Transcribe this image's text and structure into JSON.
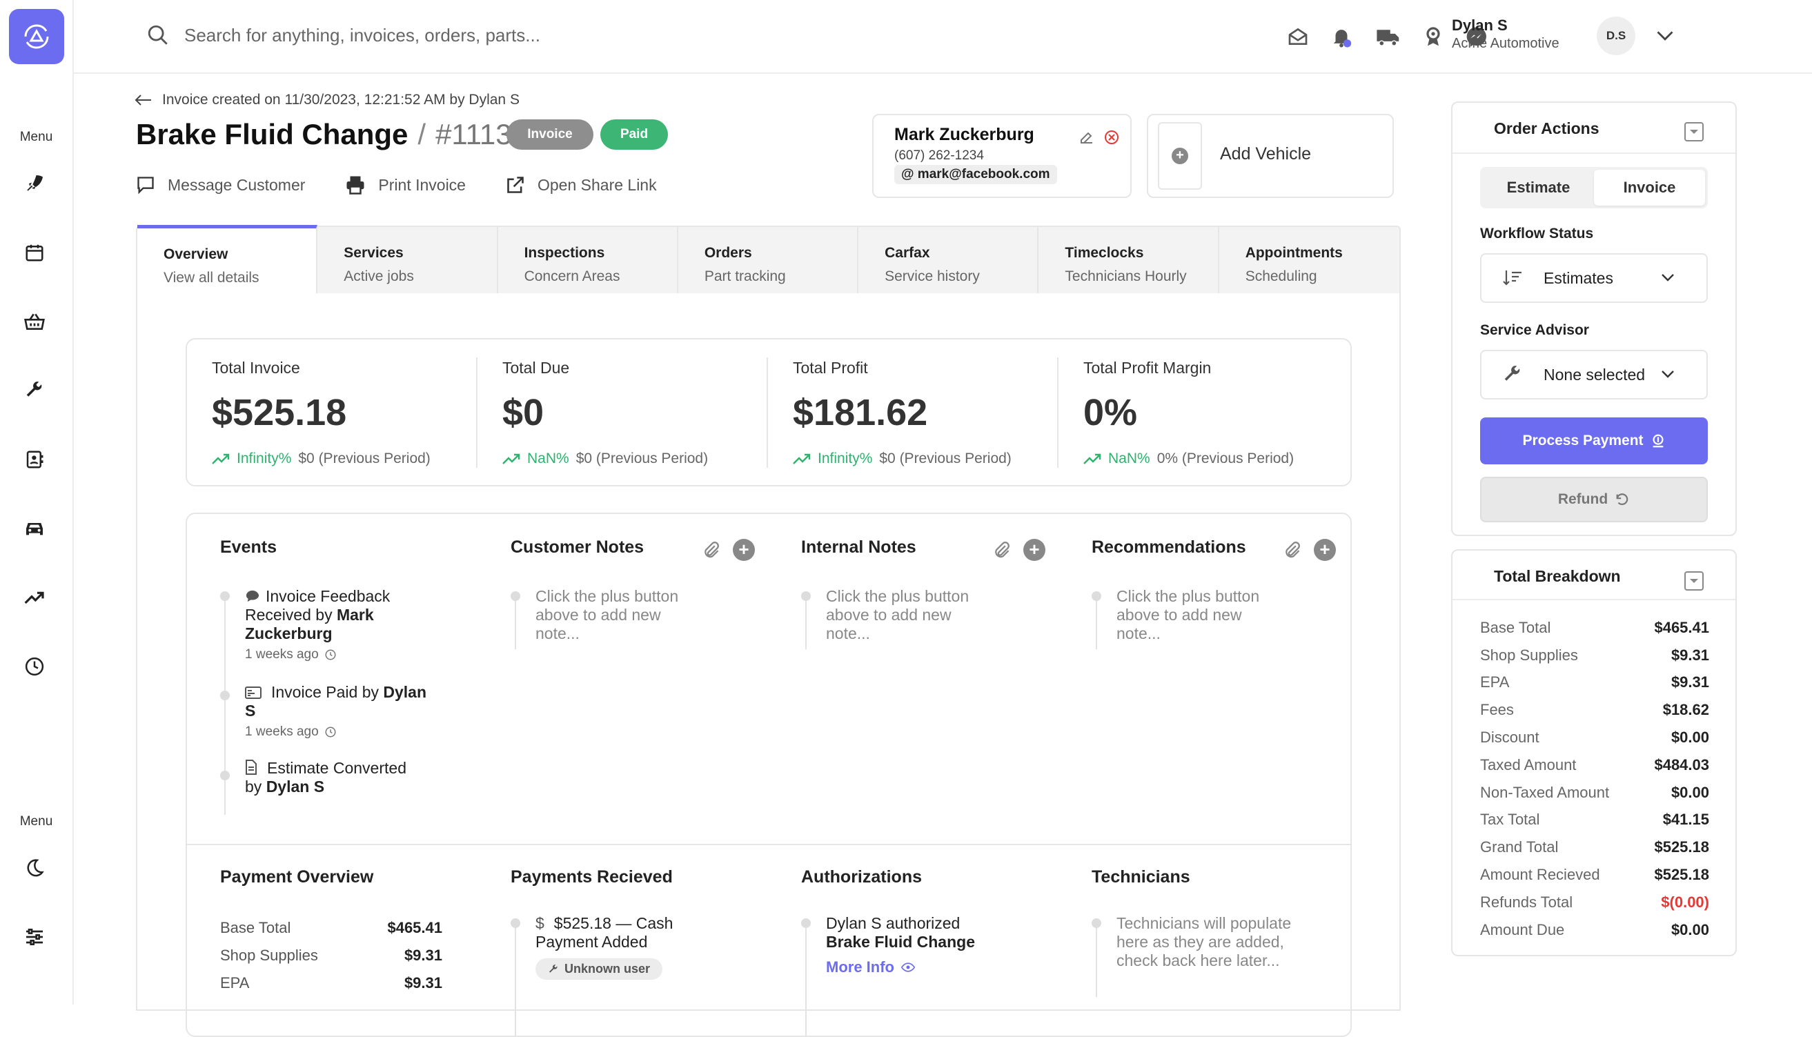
{
  "sidebar": {
    "menu_label_top": "Menu",
    "menu_label_bottom": "Menu",
    "icons": [
      "rocket-icon",
      "calendar-icon",
      "basket-icon",
      "wrench-icon",
      "contacts-icon",
      "car-icon",
      "trending-icon",
      "clock-icon",
      "moon-icon",
      "sliders-icon"
    ]
  },
  "topbar": {
    "search_placeholder": "Search for anything, invoices, orders, parts...",
    "user_name": "Dylan S",
    "user_company": "Acme Automotive",
    "avatar_initials": "D.S",
    "icons": [
      "inbox-icon",
      "bell-icon",
      "truck-icon",
      "award-icon",
      "messenger-icon"
    ]
  },
  "invoice": {
    "breadcrumb": "Invoice created on 11/30/2023, 12:21:52 AM by Dylan S",
    "title": "Brake Fluid Change",
    "separator": "/",
    "number": "#1113",
    "badge_type": "Invoice",
    "badge_status": "Paid",
    "actions": {
      "message": "Message Customer",
      "print": "Print Invoice",
      "share": "Open Share Link"
    }
  },
  "customer": {
    "name": "Mark Zuckerburg",
    "phone": "(607) 262-1234",
    "email": "@ mark@facebook.com"
  },
  "vehicle": {
    "add_label": "Add Vehicle"
  },
  "tabs": [
    {
      "title": "Overview",
      "subtitle": "View all details"
    },
    {
      "title": "Services",
      "subtitle": "Active jobs"
    },
    {
      "title": "Inspections",
      "subtitle": "Concern Areas"
    },
    {
      "title": "Orders",
      "subtitle": "Part tracking"
    },
    {
      "title": "Carfax",
      "subtitle": "Service history"
    },
    {
      "title": "Timeclocks",
      "subtitle": "Technicians Hourly"
    },
    {
      "title": "Appointments",
      "subtitle": "Scheduling"
    }
  ],
  "stats": [
    {
      "label": "Total Invoice",
      "value": "$525.18",
      "pct": "Infinity%",
      "prev": "$0 (Previous Period)"
    },
    {
      "label": "Total Due",
      "value": "$0",
      "pct": "NaN%",
      "prev": "$0 (Previous Period)"
    },
    {
      "label": "Total Profit",
      "value": "$181.62",
      "pct": "Infinity%",
      "prev": "$0 (Previous Period)"
    },
    {
      "label": "Total Profit Margin",
      "value": "0%",
      "pct": "NaN%",
      "prev": "0% (Previous Period)"
    }
  ],
  "events": {
    "title": "Events",
    "items": [
      {
        "text": "Invoice Feedback Received by",
        "bold": "Mark Zuckerburg",
        "time": "1 weeks ago"
      },
      {
        "text": "Invoice Paid by",
        "bold": "Dylan S",
        "time": "1 weeks ago"
      },
      {
        "text": "Estimate Converted by",
        "bold": "Dylan S"
      }
    ]
  },
  "customer_notes": {
    "title": "Customer Notes",
    "empty": "Click the plus button above to add new note..."
  },
  "internal_notes": {
    "title": "Internal Notes",
    "empty": "Click the plus button above to add new note..."
  },
  "recommendations": {
    "title": "Recommendations",
    "empty": "Click the plus button above to add new note..."
  },
  "payment_overview": {
    "title": "Payment Overview",
    "rows": [
      {
        "k": "Base Total",
        "v": "$465.41"
      },
      {
        "k": "Shop Supplies",
        "v": "$9.31"
      },
      {
        "k": "EPA",
        "v": "$9.31"
      }
    ]
  },
  "payments_received": {
    "title": "Payments Recieved",
    "currency": "$",
    "amount": "$525.18 — Cash",
    "label": "Payment Added",
    "user_badge": "Unknown user"
  },
  "authorizations": {
    "title": "Authorizations",
    "text": "Dylan S authorized",
    "bold": "Brake Fluid Change",
    "more": "More Info"
  },
  "technicians": {
    "title": "Technicians",
    "empty": "Technicians will populate here as they are added, check back here later..."
  },
  "order_actions": {
    "title": "Order Actions",
    "seg_estimate": "Estimate",
    "seg_invoice": "Invoice",
    "workflow_label": "Workflow Status",
    "workflow_value": "Estimates",
    "advisor_label": "Service Advisor",
    "advisor_value": "None selected",
    "process_payment": "Process Payment",
    "refund": "Refund"
  },
  "total_breakdown": {
    "title": "Total Breakdown",
    "rows": [
      {
        "k": "Base Total",
        "v": "$465.41"
      },
      {
        "k": "Shop Supplies",
        "v": "$9.31"
      },
      {
        "k": "EPA",
        "v": "$9.31"
      },
      {
        "k": "Fees",
        "v": "$18.62"
      },
      {
        "k": "Discount",
        "v": "$0.00"
      },
      {
        "k": "Taxed Amount",
        "v": "$484.03"
      },
      {
        "k": "Non-Taxed Amount",
        "v": "$0.00"
      },
      {
        "k": "Tax Total",
        "v": "$41.15"
      },
      {
        "k": "Grand Total",
        "v": "$525.18"
      },
      {
        "k": "Amount Recieved",
        "v": "$525.18"
      },
      {
        "k": "Refunds Total",
        "v": "$(0.00)"
      },
      {
        "k": "Amount Due",
        "v": "$0.00"
      }
    ]
  },
  "colors": {
    "accent": "#6c6cf0",
    "paid": "#3db574",
    "badge_grey": "#8e8e8e",
    "positive": "#2eb36e",
    "negative": "#e53935"
  }
}
